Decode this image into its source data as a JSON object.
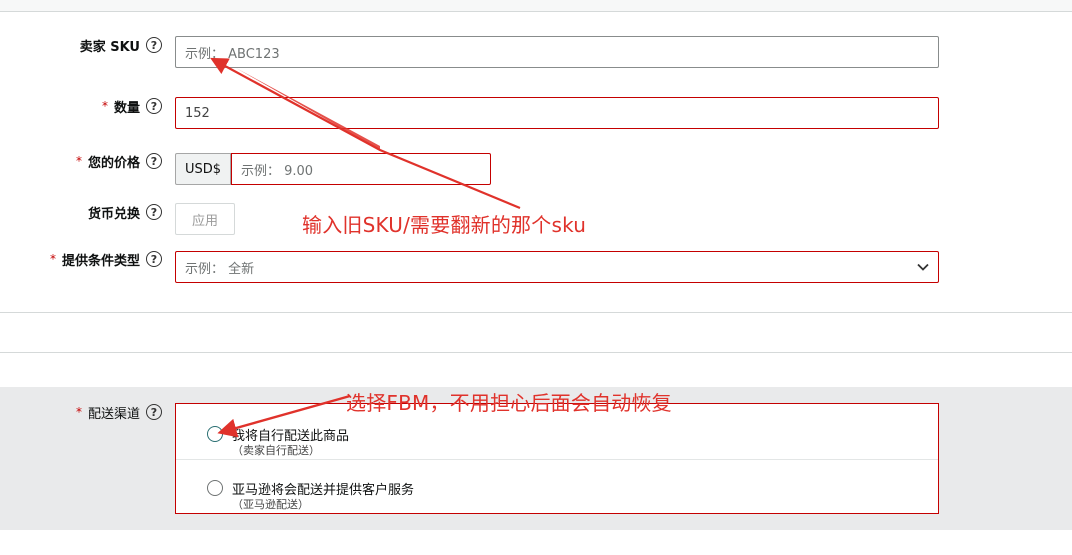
{
  "form": {
    "sku": {
      "label": "卖家 SKU",
      "placeholder": "示例： ABC123",
      "value": ""
    },
    "quantity": {
      "label": "数量",
      "value": "152"
    },
    "price": {
      "label": "您的价格",
      "currency": "USD$",
      "placeholder": "示例： 9.00",
      "value": ""
    },
    "currency_conversion": {
      "label": "货币兑换",
      "button": "应用"
    },
    "condition": {
      "label": "提供条件类型",
      "placeholder": "示例： 全新"
    },
    "help_glyph": "?",
    "required_mark": "*"
  },
  "shipping": {
    "label": "配送渠道",
    "options": [
      {
        "title": "我将自行配送此商品",
        "subtitle": "（卖家自行配送）"
      },
      {
        "title": "亚马逊将会配送并提供客户服务",
        "subtitle": "（亚马逊配送）"
      }
    ]
  },
  "annotations": {
    "sku_note": "输入旧SKU/需要翻新的那个sku",
    "fbm_note": "选择FBM，不用担心后面会自动恢复"
  },
  "colors": {
    "annotation": "#e0322b",
    "error_border": "#c40000",
    "band": "#e9eaeb"
  },
  "icons": {
    "help": "question-circle-icon",
    "dropdown": "chevron-down-icon",
    "radio": "radio-circle"
  }
}
